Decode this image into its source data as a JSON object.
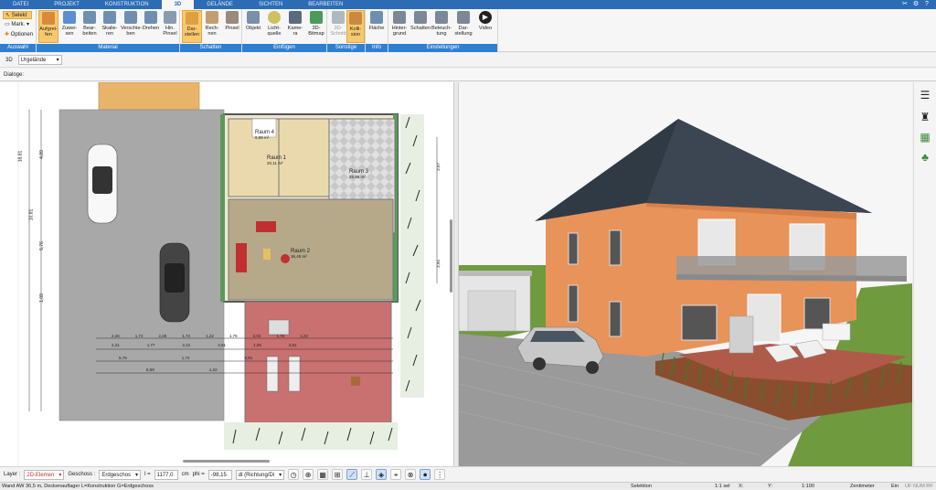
{
  "tabs": [
    {
      "label": "DATEI",
      "active": false
    },
    {
      "label": "PROJEKT",
      "active": false
    },
    {
      "label": "KONSTRUKTION",
      "active": false
    },
    {
      "label": "3D",
      "active": true
    },
    {
      "label": "GELÄNDE",
      "active": false
    },
    {
      "label": "SICHTEN",
      "active": false
    },
    {
      "label": "BEARBEITEN",
      "active": false
    }
  ],
  "ribbon": {
    "auswahl": {
      "label": "Auswahl",
      "selekt": "Selekt",
      "mark": "Mark.",
      "optionen": "Optionen"
    },
    "material": {
      "label": "Material",
      "buttons": [
        "Aufgrei- fen",
        "Zuwei- sen",
        "Bear- beiten",
        "Skalie- ren",
        "Verschie- ben",
        "Drehen",
        "Hin. Pinsel"
      ]
    },
    "schatten": {
      "label": "Schatten",
      "buttons": [
        "Dar- stellen",
        "Rech- nen",
        "Pinsel"
      ]
    },
    "einfuegen": {
      "label": "Einfügen",
      "buttons": [
        "Objekt",
        "Licht- quelle",
        "Kame- ra",
        "3D- Bitmap"
      ]
    },
    "sonstige": {
      "label": "Sonstige",
      "buttons": [
        "3D- Schnitt",
        "Kolli- sion"
      ]
    },
    "info": {
      "label": "Info",
      "buttons": [
        "Fläche"
      ]
    },
    "einstellungen": {
      "label": "Einstellungen",
      "buttons": [
        "Hinter- grund",
        "Schatten",
        "Beleuch- tung",
        "Dar- stellung",
        "Video"
      ]
    }
  },
  "bar3d": {
    "mode": "3D",
    "terrain": "Urgelände"
  },
  "dialoge": "Dialoge:",
  "plan": {
    "rooms": [
      {
        "name": "Raum 4",
        "area": "6,89 m²"
      },
      {
        "name": "Raum 1",
        "area": "20,11 m²"
      },
      {
        "name": "Raum 3",
        "area": "25,95 m²"
      },
      {
        "name": "Raum 2",
        "area": "36,45 m²"
      }
    ],
    "dims_left": [
      "18,81",
      "4,89",
      "10,81",
      "5,76",
      "1,09"
    ],
    "dims_row1": [
      "2,26",
      "1,72",
      "2,26",
      "1,72",
      "1,22",
      "1,76",
      "2,02",
      "1,76",
      "1,22"
    ],
    "dims_row2": [
      "2,21",
      "1,77",
      "2,21",
      "2,51",
      "1,06",
      "2,01"
    ],
    "dims_row3": [
      "5,76",
      "1,72",
      "8,91"
    ],
    "dims_row4": [
      "8,59",
      "1,22"
    ],
    "dims_right": [
      "3,97",
      "3,94"
    ]
  },
  "bottombar": {
    "layer_label": "Layer :",
    "layer_value": "2D-Elemen",
    "geschoss_label": "Geschoss :",
    "geschoss_value": "Erdgeschos",
    "l_label": "l =",
    "l_value": "1177,0",
    "l_unit": "cm",
    "phi_label": "phi =",
    "phi_value": "-98,15",
    "dl_value": "dl (Richtung/Di"
  },
  "statusbar": {
    "left": "Wand AW 36,5 m, Deckenauflager L=Konstruktion G=Erdgeschoss",
    "selektion": "Selektion",
    "scale": "1:1 sel",
    "x": "X:",
    "y": "Y:",
    "ratio": "1:100",
    "unit": "Zentimeter",
    "ein": "Ein",
    "flags": "UF NUM RF"
  },
  "colors": {
    "tab_bar": "#2b6cb5",
    "ribbon_group_label": "#2f7fd1",
    "active_button": "#f8c86e",
    "facade": "#e8935a",
    "roof": "#2f3a45"
  }
}
